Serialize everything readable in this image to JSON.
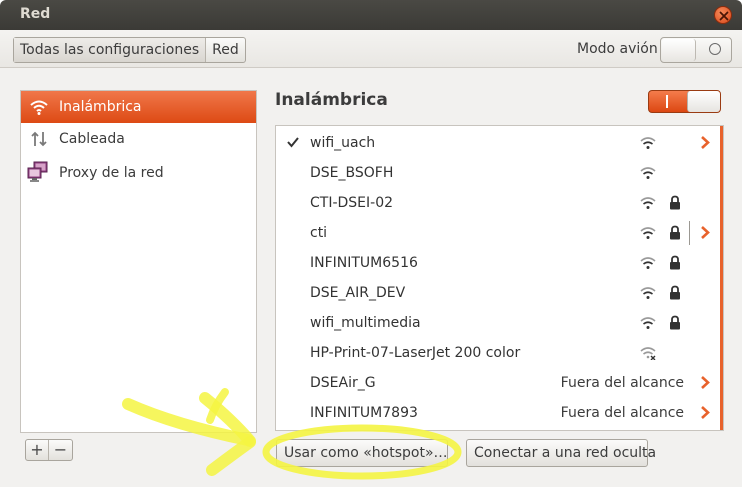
{
  "window": {
    "title": "Red"
  },
  "toolbar": {
    "breadcrumbs": [
      "Todas las configuraciones",
      "Red"
    ],
    "airplane_label": "Modo avión",
    "airplane_enabled": false
  },
  "sidebar": {
    "items": [
      {
        "label": "Inalámbrica",
        "icon": "wifi-icon",
        "active": true
      },
      {
        "label": "Cableada",
        "icon": "wired-arrows-icon",
        "active": false
      },
      {
        "label": "Proxy de la red",
        "icon": "proxy-network-icon",
        "active": false
      }
    ],
    "add_label": "+",
    "remove_label": "−"
  },
  "main": {
    "title": "Inalámbrica",
    "wifi_enabled": true,
    "networks": [
      {
        "ssid": "wifi_uach",
        "connected": true,
        "signal": "wifi-signal-icon",
        "locked": false,
        "status": "",
        "arrow": true
      },
      {
        "ssid": "DSE_BSOFH",
        "connected": false,
        "signal": "wifi-signal-icon",
        "locked": false,
        "status": "",
        "arrow": false
      },
      {
        "ssid": "CTI-DSEI-02",
        "connected": false,
        "signal": "wifi-signal-icon",
        "locked": true,
        "status": "",
        "arrow": false
      },
      {
        "ssid": "cti",
        "connected": false,
        "signal": "wifi-signal-icon",
        "locked": true,
        "status": "",
        "arrow": true
      },
      {
        "ssid": "INFINITUM6516",
        "connected": false,
        "signal": "wifi-signal-icon",
        "locked": true,
        "status": "",
        "arrow": false
      },
      {
        "ssid": "DSE_AIR_DEV",
        "connected": false,
        "signal": "wifi-signal-icon",
        "locked": true,
        "status": "",
        "arrow": false
      },
      {
        "ssid": "wifi_multimedia",
        "connected": false,
        "signal": "wifi-signal-icon",
        "locked": true,
        "status": "",
        "arrow": false
      },
      {
        "ssid": "HP-Print-07-LaserJet 200 color",
        "connected": false,
        "signal": "wifi-adhoc-icon",
        "locked": false,
        "status": "",
        "arrow": false
      },
      {
        "ssid": "DSEAir_G",
        "connected": false,
        "signal": "",
        "locked": false,
        "status": "Fuera del alcance",
        "arrow": true
      },
      {
        "ssid": "INFINITUM7893",
        "connected": false,
        "signal": "",
        "locked": false,
        "status": "Fuera del alcance",
        "arrow": true
      }
    ],
    "hotspot_button": "Usar como «hotspot»…",
    "hidden_network_button": "Conectar a una red oculta"
  },
  "colors": {
    "accent": "#e8622c",
    "highlight_annotation": "#f4f442"
  }
}
